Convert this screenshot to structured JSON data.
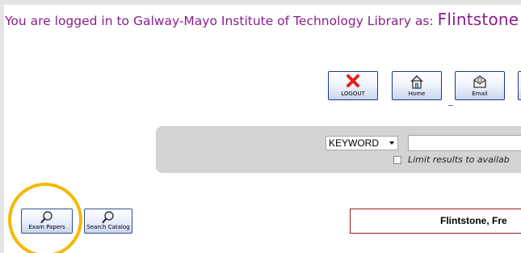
{
  "login": {
    "prefix": "You are logged in to Galway-Mayo Institute of Technology Library as: ",
    "user": "Flintstone"
  },
  "toolbar": {
    "buttons": [
      {
        "label": "LOGOUT",
        "icon": "close-icon"
      },
      {
        "label": "Home",
        "icon": "home-icon"
      },
      {
        "label": "Email",
        "icon": "email-icon"
      }
    ]
  },
  "search": {
    "index_selected": "KEYWORD",
    "query_value": "",
    "limit_label": "Limit results to availab"
  },
  "bottom_buttons": [
    {
      "label": "Exam Papers",
      "icon": "magnifier-icon"
    },
    {
      "label": "Search Catalog",
      "icon": "magnifier-icon"
    }
  ],
  "patron": {
    "name_display": "Flintstone, Fre"
  },
  "colors": {
    "login_text": "#8a1f8a",
    "search_panel": "#d3d3d3",
    "highlight": "#f5b800",
    "name_box_border": "#a01818",
    "button_border": "#1a3b8b"
  }
}
